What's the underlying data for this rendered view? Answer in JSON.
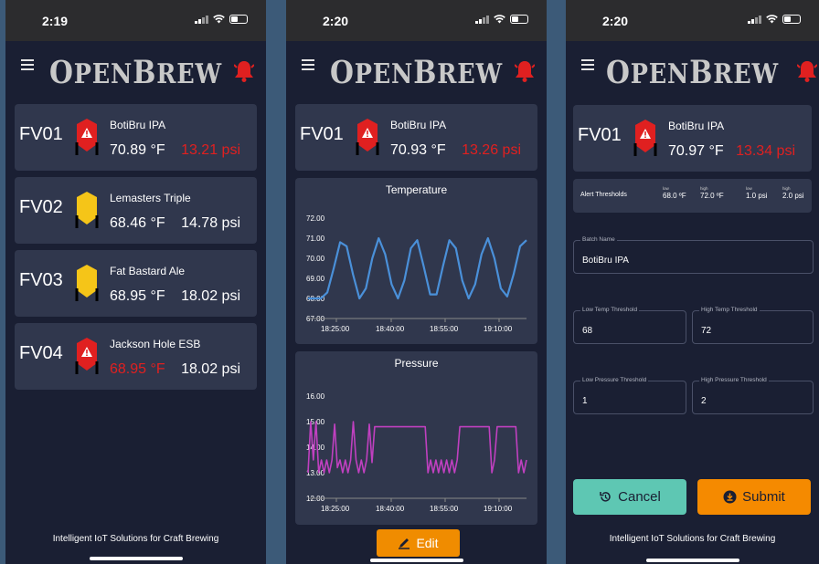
{
  "brand": {
    "name_big1": "O",
    "name_small1": "PEN",
    "name_big2": "B",
    "name_small2": "REW"
  },
  "colors": {
    "background": "#1a1f33",
    "card": "#30374d",
    "alert_red": "#e02020",
    "warning_yellow": "#f5c518",
    "temp_line": "#4a90d9",
    "pressure_line": "#c040c0",
    "cancel": "#5ec7b3",
    "submit": "#f58a00"
  },
  "screen1": {
    "status_time": "2:19",
    "fermenters": [
      {
        "id": "FV01",
        "batch": "BotiBru IPA",
        "temp": "70.89 °F",
        "pressure": "13.21 psi",
        "status": "alert",
        "temp_alert": false,
        "pressure_alert": true
      },
      {
        "id": "FV02",
        "batch": "Lemasters Triple",
        "temp": "68.46 °F",
        "pressure": "14.78 psi",
        "status": "ok",
        "temp_alert": false,
        "pressure_alert": false
      },
      {
        "id": "FV03",
        "batch": "Fat Bastard Ale",
        "temp": "68.95 °F",
        "pressure": "18.02 psi",
        "status": "ok",
        "temp_alert": false,
        "pressure_alert": false
      },
      {
        "id": "FV04",
        "batch": "Jackson Hole ESB",
        "temp": "68.95 °F",
        "pressure": "18.02 psi",
        "status": "alert",
        "temp_alert": true,
        "pressure_alert": false
      }
    ],
    "footer": "Intelligent IoT Solutions for Craft Brewing"
  },
  "screen2": {
    "status_time": "2:20",
    "fermenter": {
      "id": "FV01",
      "batch": "BotiBru IPA",
      "temp": "70.93 °F",
      "pressure": "13.26 psi"
    },
    "edit_label": "Edit"
  },
  "screen3": {
    "status_time": "2:20",
    "fermenter": {
      "id": "FV01",
      "batch": "BotiBru IPA",
      "temp": "70.97 °F",
      "pressure": "13.34 psi"
    },
    "alert_thresholds": {
      "label": "Alert Thresholds",
      "items": [
        {
          "small": "low",
          "value": "68.0 ºF"
        },
        {
          "small": "high",
          "value": "72.0 ºF"
        },
        {
          "small": "low",
          "value": "1.0 psi"
        },
        {
          "small": "high",
          "value": "2.0 psi"
        }
      ]
    },
    "form": {
      "batch_name": {
        "label": "Batch Name",
        "value": "BotiBru IPA"
      },
      "low_temp": {
        "label": "Low Temp Threshold",
        "value": "68"
      },
      "high_temp": {
        "label": "High Temp Threshold",
        "value": "72"
      },
      "low_pressure": {
        "label": "Low Pressure Threshold",
        "value": "1"
      },
      "high_pressure": {
        "label": "High Pressure Threshold",
        "value": "2"
      }
    },
    "cancel_label": "Cancel",
    "submit_label": "Submit",
    "footer": "Intelligent IoT Solutions for Craft Brewing"
  },
  "chart_data": [
    {
      "type": "line",
      "title": "Temperature",
      "ylim": [
        67.0,
        72.0
      ],
      "y_ticks": [
        "72.00",
        "71.00",
        "70.00",
        "69.00",
        "68.00",
        "67.00"
      ],
      "x_ticks": [
        "18:25:00",
        "18:40:00",
        "18:55:00",
        "19:10:00"
      ],
      "series": [
        {
          "values": [
            68.0,
            68.0,
            68.0,
            68.3,
            69.5,
            70.8,
            70.6,
            69.2,
            68.0,
            68.5,
            70.0,
            71.0,
            70.2,
            68.7,
            68.0,
            68.9,
            70.5,
            70.9,
            69.6,
            68.2,
            68.2,
            69.6,
            70.9,
            70.5,
            68.9,
            68.0,
            68.7,
            70.2,
            71.0,
            70.0,
            68.5,
            68.1,
            69.2,
            70.6,
            70.9
          ]
        }
      ]
    },
    {
      "type": "line",
      "title": "Pressure",
      "ylim": [
        12.0,
        16.0
      ],
      "y_ticks": [
        "16.00",
        "15.00",
        "14.00",
        "13.00",
        "12.00"
      ],
      "x_ticks": [
        "18:25:00",
        "18:40:00",
        "18:55:00",
        "19:10:00"
      ],
      "series": [
        {
          "values": [
            13.0,
            15.0,
            13.5,
            15.0,
            13.0,
            13.5,
            13.0,
            13.5,
            13.0,
            13.5,
            14.9,
            13.2,
            13.5,
            13.0,
            13.5,
            13.0,
            13.5,
            15.0,
            13.5,
            13.0,
            13.5,
            13.0,
            13.5,
            14.9,
            13.4,
            14.8,
            14.8,
            14.8,
            14.8,
            14.8,
            14.8,
            14.8,
            14.8,
            14.8,
            14.8,
            14.8,
            14.8,
            14.8,
            14.8,
            14.8,
            14.8,
            14.8,
            14.8,
            14.8,
            14.8,
            13.0,
            13.5,
            13.0,
            13.5,
            13.0,
            13.5,
            13.0,
            13.5,
            13.0,
            13.5,
            13.0,
            13.5,
            14.8,
            14.8,
            14.8,
            14.8,
            14.8,
            14.8,
            14.8,
            14.8,
            14.8,
            14.8,
            14.8,
            14.8,
            13.0,
            13.5,
            14.8,
            14.8,
            14.8,
            14.8,
            14.8,
            14.8,
            14.8,
            14.8,
            13.0,
            13.5,
            13.0,
            13.5
          ]
        }
      ]
    }
  ]
}
